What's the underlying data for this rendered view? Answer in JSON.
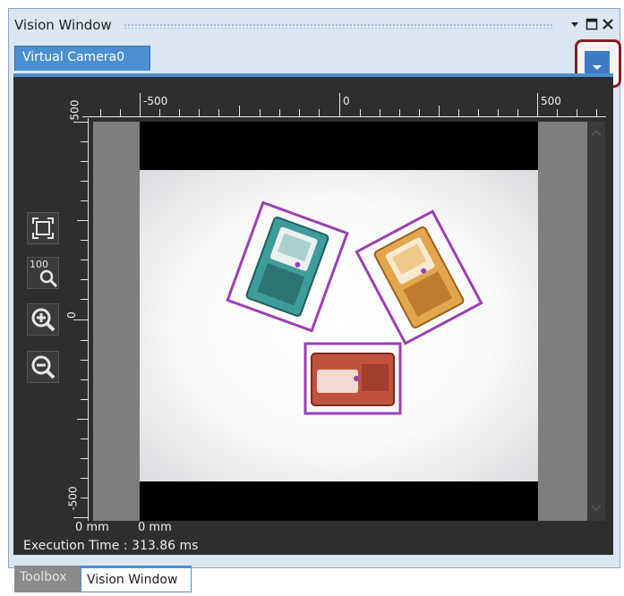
{
  "window": {
    "title": "Vision Window",
    "pin_icon": "pin-dropdown-icon",
    "maximize_icon": "maximize-icon",
    "close_icon": "close-icon"
  },
  "camera_tab": {
    "label": "Virtual Camera0"
  },
  "dropdown_button": {
    "icon": "chevron-down-icon"
  },
  "ruler_top": {
    "labels": [
      "-500",
      "0",
      "500"
    ]
  },
  "ruler_left": {
    "labels": [
      "500",
      "0",
      "-500"
    ]
  },
  "zoom_tools": [
    {
      "name": "fit-to-window-icon"
    },
    {
      "name": "zoom-100-icon",
      "label": "100"
    },
    {
      "name": "zoom-in-icon"
    },
    {
      "name": "zoom-out-icon"
    }
  ],
  "status": {
    "coord_x": "0 mm",
    "coord_y": "0 mm",
    "execution_time": "Execution Time : 313.86 ms"
  },
  "bottom_tabs": [
    {
      "label": "Toolbox",
      "active": false
    },
    {
      "label": "Vision Window",
      "active": true
    }
  ],
  "colors": {
    "accent": "#4a90d0",
    "detection": "#9b3fb3",
    "panel_bg": "#2e2e2e"
  }
}
